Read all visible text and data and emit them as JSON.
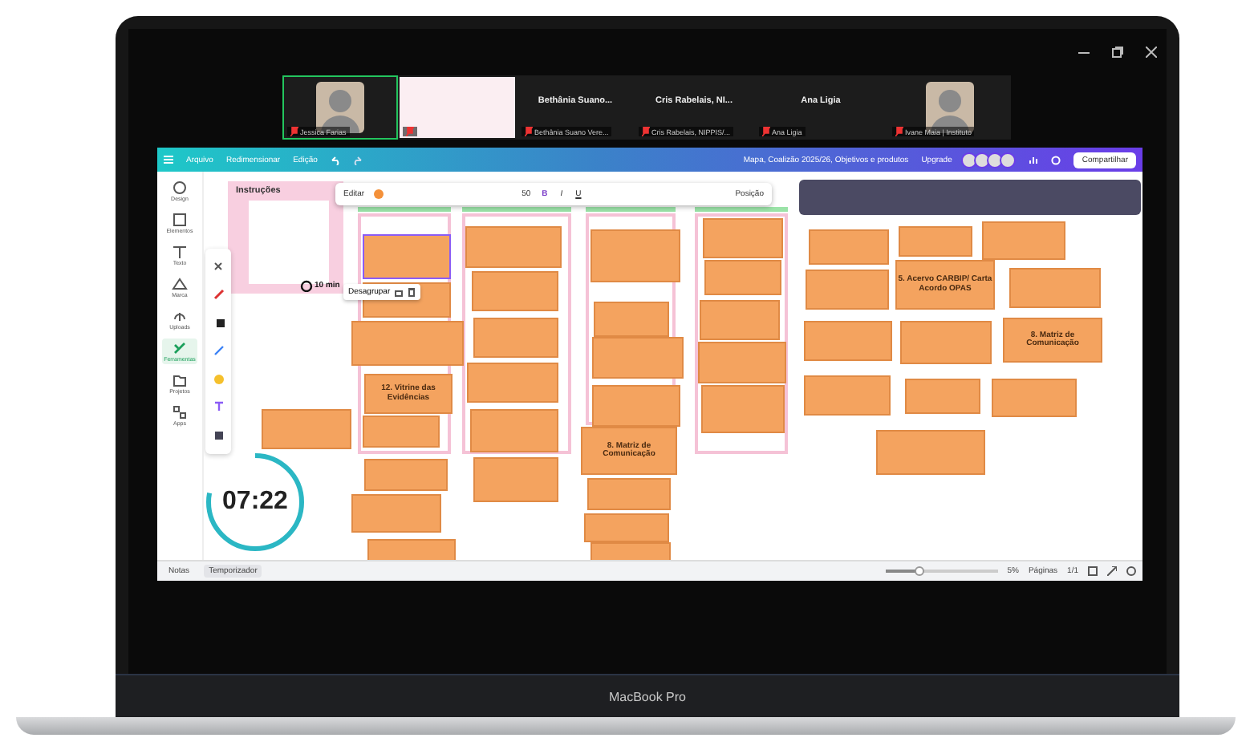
{
  "meeting": {
    "participants": [
      {
        "kind": "video",
        "label": "Jessica Farias",
        "speaking": true
      },
      {
        "kind": "slide",
        "speaking": false
      },
      {
        "kind": "name",
        "heading": "Bethânia Suano...",
        "label": "Bethânia Suano Vere...",
        "speaking": false
      },
      {
        "kind": "name",
        "heading": "Cris Rabelais, NI...",
        "label": "Cris Rabelais, NIPPIS/...",
        "speaking": false
      },
      {
        "kind": "name",
        "heading": "Ana Ligia",
        "label": "Ana Ligia",
        "speaking": false
      },
      {
        "kind": "video",
        "label": "Ivane Maia | Instituto",
        "speaking": false
      }
    ]
  },
  "app": {
    "menu": [
      "Arquivo",
      "Redimensionar",
      "Edição"
    ],
    "title": "Mapa, Coalizão 2025/26, Objetivos e produtos",
    "upgrade": "Upgrade",
    "share": "Compartilhar",
    "sidebar": [
      {
        "label": "Design",
        "selected": false
      },
      {
        "label": "Elementos",
        "selected": false
      },
      {
        "label": "Texto",
        "selected": false
      },
      {
        "label": "Marca",
        "selected": false
      },
      {
        "label": "Uploads",
        "selected": false
      },
      {
        "label": "Ferramentas",
        "selected": true
      },
      {
        "label": "Projetos",
        "selected": false
      },
      {
        "label": "Apps",
        "selected": false
      }
    ],
    "instructions": {
      "title": "Instruções"
    },
    "text_toolbar": {
      "edit": "Editar",
      "size": "50",
      "format_buttons": [
        "B",
        "I",
        "U"
      ],
      "position": "Posição"
    },
    "group_toolbar": {
      "timer": "10 min",
      "ungroup": "Desagrupar"
    },
    "timer": {
      "time": "07:22",
      "level": 0.78
    },
    "notes": [
      {
        "selected": true
      },
      {
        "selected": false
      },
      {
        "selected": false
      },
      {
        "text": "12. Vitrine das Evidências",
        "selected": false
      },
      {
        "selected": false
      },
      {
        "selected": false
      },
      {
        "selected": false
      },
      {
        "selected": false
      },
      {
        "selected": false
      },
      {
        "selected": false
      },
      {
        "selected": false
      },
      {
        "selected": false
      },
      {
        "selected": false
      },
      {
        "selected": false
      },
      {
        "selected": false
      },
      {
        "selected": false
      },
      {
        "selected": false
      },
      {
        "selected": false
      },
      {
        "selected": false
      },
      {
        "text": "8. Matriz de Comunicação",
        "selected": false
      },
      {
        "selected": false
      },
      {
        "selected": false
      },
      {
        "selected": false
      },
      {
        "selected": false
      },
      {
        "selected": false
      },
      {
        "selected": false
      },
      {
        "selected": false
      },
      {
        "selected": false
      },
      {
        "selected": false
      },
      {
        "selected": false
      },
      {
        "selected": false
      },
      {
        "selected": false
      },
      {
        "text": "5. Acervo CARBIP/ Carta Acordo OPAS",
        "selected": false
      },
      {
        "selected": false
      },
      {
        "selected": false
      },
      {
        "selected": false
      },
      {
        "text": "8. Matriz de Comunicação",
        "selected": false
      },
      {
        "selected": false
      },
      {
        "selected": false
      },
      {
        "selected": false
      },
      {
        "selected": false
      }
    ],
    "footer": {
      "notes": "Notas",
      "timer": "Temporizador",
      "zoom": {
        "reading": "5%",
        "level": 0.3
      },
      "pages": "Páginas",
      "page_count": "1/1"
    }
  },
  "device": {
    "label": "MacBook Pro"
  }
}
